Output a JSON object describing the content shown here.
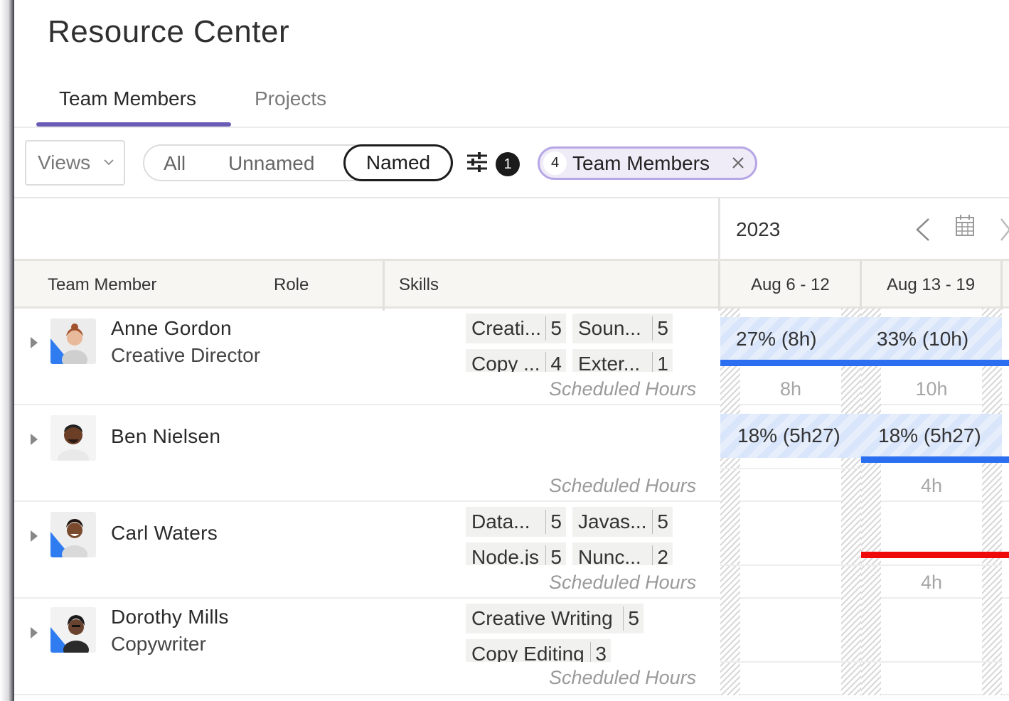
{
  "page": {
    "title": "Resource Center"
  },
  "tabs": [
    {
      "label": "Team Members",
      "active": true
    },
    {
      "label": "Projects",
      "active": false
    }
  ],
  "toolbar": {
    "views_label": "Views",
    "segments": [
      "All",
      "Unnamed",
      "Named"
    ],
    "selected_segment": "Named",
    "filter_count": "1",
    "chip_count": "4",
    "chip_label": "Team Members"
  },
  "timeline": {
    "year": "2023",
    "weeks": [
      "Aug 6 - 12",
      "Aug 13 - 19"
    ]
  },
  "grid": {
    "headers": {
      "member": "Team Member",
      "role": "Role",
      "skills": "Skills"
    },
    "scheduled_label": "Scheduled Hours"
  },
  "members": [
    {
      "name": "Anne Gordon",
      "role": "Creative Director",
      "skills": [
        {
          "name": "Creati...",
          "level": "5"
        },
        {
          "name": "Soun...",
          "level": "5"
        },
        {
          "name": "Copy ...",
          "level": "4"
        },
        {
          "name": "Exter...",
          "level": "1"
        }
      ],
      "week1": {
        "allocation": "27% (8h)",
        "hours": "8h"
      },
      "week2": {
        "allocation": "33% (10h)",
        "hours": "10h"
      }
    },
    {
      "name": "Ben Nielsen",
      "role": "",
      "skills": [],
      "week1": {
        "allocation": "18% (5h27)",
        "hours": ""
      },
      "week2": {
        "allocation": "18% (5h27)",
        "hours": "4h"
      }
    },
    {
      "name": "Carl Waters",
      "role": "",
      "skills": [
        {
          "name": "Data...",
          "level": "5"
        },
        {
          "name": "Javas...",
          "level": "5"
        },
        {
          "name": "Node.js",
          "level": "5"
        },
        {
          "name": "Nunc...",
          "level": "2"
        }
      ],
      "week1": {
        "allocation": "",
        "hours": ""
      },
      "week2": {
        "allocation": "",
        "hours": "4h"
      }
    },
    {
      "name": "Dorothy Mills",
      "role": "Copywriter",
      "skills": [
        {
          "name": "Creative Writing",
          "level": "5"
        },
        {
          "name": "Copy Editing",
          "level": "3"
        }
      ],
      "week1": {
        "allocation": "",
        "hours": ""
      },
      "week2": {
        "allocation": "",
        "hours": ""
      }
    }
  ],
  "colors": {
    "accent": "#6a5bb6",
    "chip_border": "#b7a7e6",
    "bar_blue": "#2b6ff0",
    "bar_red": "#ee0a0a"
  }
}
